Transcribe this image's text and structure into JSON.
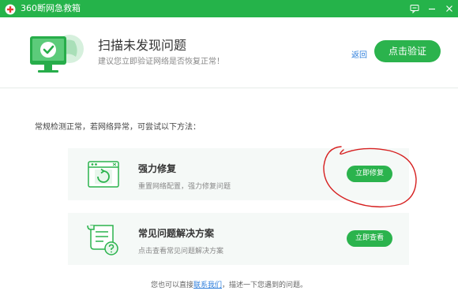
{
  "window": {
    "title": "360断网急救箱",
    "accent": "#25b34a"
  },
  "header": {
    "title": "扫描未发现问题",
    "subtitle": "建议您立即验证网络是否恢复正常！",
    "back_label": "返回",
    "verify_label": "点击验证"
  },
  "hint": "常规检测正常，若网络异常，可尝试以下方法：",
  "cards": [
    {
      "title": "强力修复",
      "desc": "重置网络配置，强力修复问题",
      "button": "立即修复",
      "icon": "repair-window-icon"
    },
    {
      "title": "常见问题解决方案",
      "desc": "点击查看常见问题解决方案",
      "button": "立即查看",
      "icon": "faq-scroll-icon"
    }
  ],
  "footer": {
    "prefix": "您也可以直接",
    "link": "联系我们",
    "suffix": "，描述一下您遇到的问题。"
  },
  "colors": {
    "button": "#2bb34d",
    "link": "#2f7fdc",
    "annotation": "#d62020"
  }
}
